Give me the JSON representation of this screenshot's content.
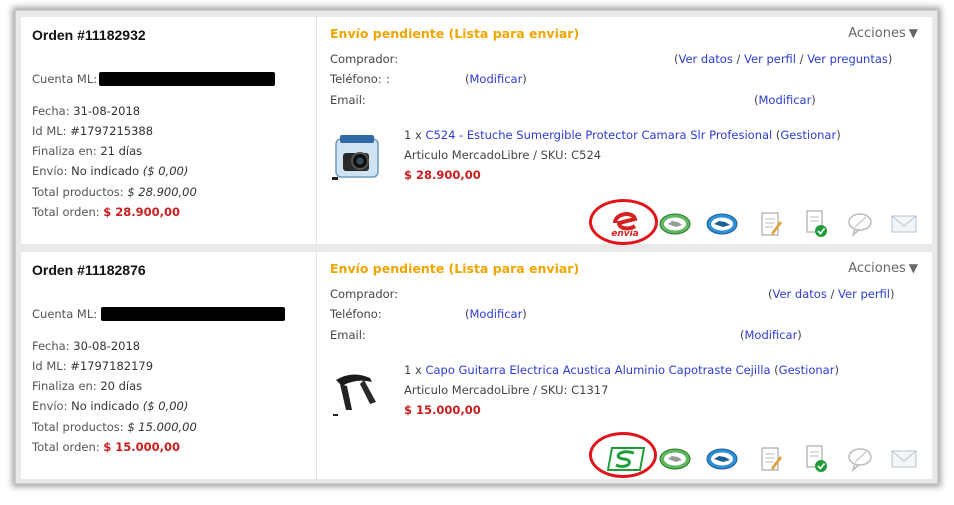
{
  "orders": [
    {
      "title": "Orden #11182932",
      "cuenta_label": "Cuenta ML:",
      "fecha_label": "Fecha:",
      "fecha": "31-08-2018",
      "id_label": "Id ML:",
      "id": "#1797215388",
      "finaliza_label": "Finaliza en:",
      "finaliza": "21 días",
      "envio_label": "Envío:",
      "envio": "No indicado",
      "envio_cost": "($ 0,00)",
      "total_productos_label": "Total productos:",
      "total_productos": "$ 28.900,00",
      "total_orden_label": "Total orden:",
      "total_orden": "$ 28.900,00",
      "status": "Envío pendiente (Lista para enviar)",
      "acciones": "Acciones",
      "comprador_label": "Comprador:",
      "telefono_label": "Teléfono:",
      "telefono_value": ":",
      "email_label": "Email:",
      "modificar": "Modificar",
      "ver_datos": "Ver datos",
      "ver_perfil": "Ver perfil",
      "ver_preguntas": "Ver preguntas",
      "product": {
        "qty": "1 x",
        "name": "C524 - Estuche Sumergible Protector Camara Slr Profesional",
        "gestionar": "Gestionar",
        "sku_line": "Articulo MercadoLibre / SKU: C524",
        "price": "$ 28.900,00"
      },
      "shipping_logo": "envia-logo"
    },
    {
      "title": "Orden #11182876",
      "cuenta_label": "Cuenta ML:",
      "fecha_label": "Fecha:",
      "fecha": "30-08-2018",
      "id_label": "Id ML:",
      "id": "#1797182179",
      "finaliza_label": "Finaliza en:",
      "finaliza": "20 días",
      "envio_label": "Envío:",
      "envio": "No indicado",
      "envio_cost": "($ 0,00)",
      "total_productos_label": "Total productos:",
      "total_productos": "$ 15.000,00",
      "total_orden_label": "Total orden:",
      "total_orden": "$ 15.000,00",
      "status": "Envío pendiente (Lista para enviar)",
      "acciones": "Acciones",
      "comprador_label": "Comprador:",
      "telefono_label": "Teléfono:",
      "email_label": "Email:",
      "modificar": "Modificar",
      "ver_datos": "Ver datos",
      "ver_perfil": "Ver perfil",
      "product": {
        "qty": "1 x",
        "name": "Capo Guitarra Electrica Acustica Aluminio Capotraste Cejilla",
        "gestionar": "Gestionar",
        "sku_line": "Articulo MercadoLibre / SKU: C1317",
        "price": "$ 15.000,00"
      },
      "shipping_logo": "servientrega-logo"
    }
  ],
  "envia_logo_text": "envia",
  "colors": {
    "status": "#f0a500",
    "link": "#2d3ccf",
    "price": "#c81e1e",
    "highlight": "#e0141a"
  }
}
